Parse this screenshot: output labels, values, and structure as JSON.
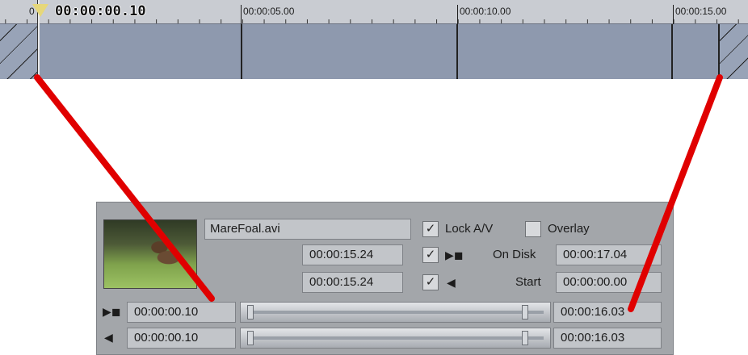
{
  "timeline": {
    "current_time": "00:00:00.10",
    "ruler_start": "0",
    "ruler_labels": [
      "00:00:05.00",
      "00:00:10.00",
      "00:00:15.00"
    ]
  },
  "clip": {
    "file_name": "MareFoal.avi",
    "video_length": "00:00:15.24",
    "audio_length": "00:00:15.24",
    "lock_av_label": "Lock A/V",
    "lock_av_checked": true,
    "overlay_label": "Overlay",
    "overlay_checked": false,
    "video_checked": true,
    "audio_checked": true,
    "on_disk_label": "On Disk",
    "on_disk_value": "00:00:17.04",
    "start_label": "Start",
    "start_value": "00:00:00.00",
    "video_in": "00:00:00.10",
    "video_out": "00:00:16.03",
    "audio_in": "00:00:00.10",
    "audio_out": "00:00:16.03",
    "checkmark_glyph": "✓",
    "video_icon_glyph": "▶◼",
    "audio_icon_glyph": "◀",
    "video_icon": "video-camera-icon",
    "audio_icon": "speaker-icon"
  },
  "colors": {
    "annotation": "#e00000",
    "track": "#8e99ae",
    "panel": "#a3a6aa"
  }
}
